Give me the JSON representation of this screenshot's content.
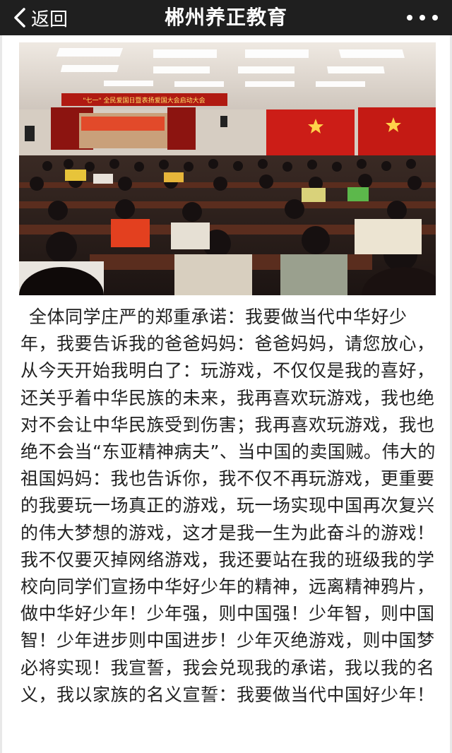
{
  "navbar": {
    "back_label": "返回",
    "title": "郴州养正教育"
  },
  "photo": {
    "banner_text": "\"七一\" 全民爱国日暨表扬爱国大会启动大会"
  },
  "article": {
    "text": "全体同学庄严的郑重承诺：我要做当代中华好少年，我要告诉我的爸爸妈妈：爸爸妈妈，请您放心，从今天开始我明白了：玩游戏，不仅仅是我的喜好，还关乎着中华民族的未来，我再喜欢玩游戏，我也绝对不会让中华民族受到伤害；我再喜欢玩游戏，我也绝不会当“东亚精神病夫”、当中国的卖国贼。伟大的祖国妈妈：我也告诉你，我不仅不再玩游戏，更重要的我要玩一场真正的游戏，玩一场实现中国再次复兴的伟大梦想的游戏，这才是我一生为此奋斗的游戏！我不仅要灭掉网络游戏，我还要站在我的班级我的学校向同学们宣扬中华好少年的精神，远离精神鸦片，做中华好少年！少年强，则中国强！少年智，则中国智！少年进步则中国进步！少年灭绝游戏，则中国梦必将实现！我宣誓，我会兑现我的承诺，我以我的名义，我以家族的名义宣誓：我要做当代中国好少年！"
  },
  "colors": {
    "navbar_bg": "#1f1f1f",
    "text": "#222222",
    "banner_red": "#b01a12"
  },
  "icons": {
    "back": "chevron-left-icon",
    "more": "more-dots-icon"
  }
}
